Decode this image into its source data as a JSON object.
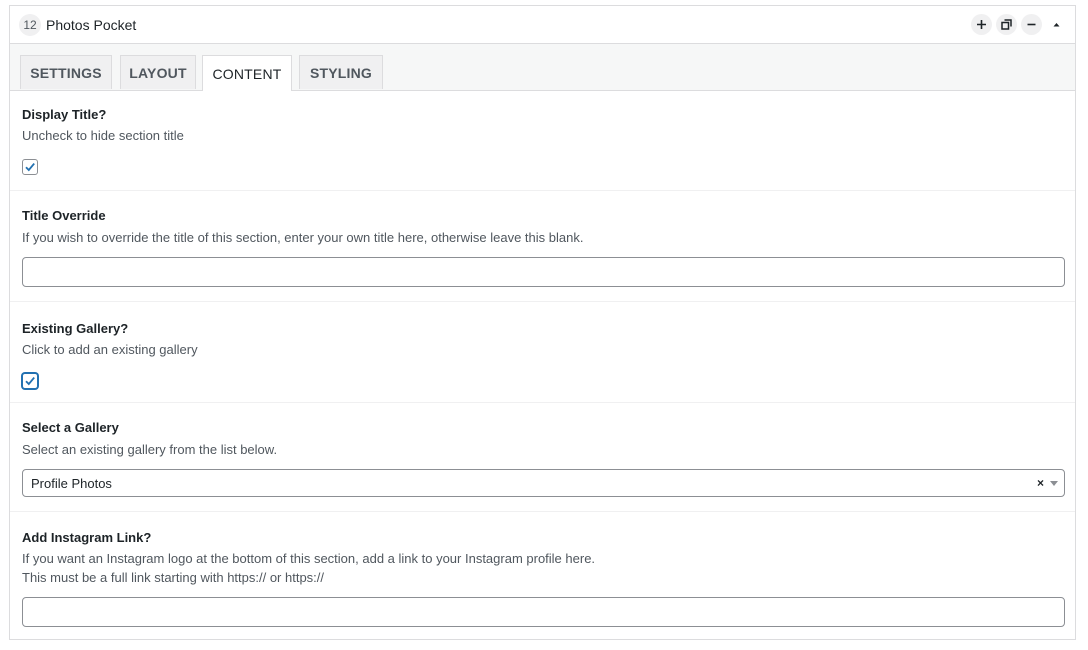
{
  "header": {
    "badge": "12",
    "title": "Photos Pocket"
  },
  "tabs": [
    {
      "label": "SETTINGS"
    },
    {
      "label": "LAYOUT"
    },
    {
      "label": "CONTENT"
    },
    {
      "label": "STYLING"
    }
  ],
  "fields": {
    "display_title": {
      "label": "Display Title?",
      "desc": "Uncheck to hide section title",
      "checked": true
    },
    "title_override": {
      "label": "Title Override",
      "desc": "If you wish to override the title of this section, enter your own title here, otherwise leave this blank.",
      "value": ""
    },
    "existing_gallery": {
      "label": "Existing Gallery?",
      "desc": "Click to add an existing gallery",
      "checked": true
    },
    "select_gallery": {
      "label": "Select a Gallery",
      "desc": "Select an existing gallery from the list below.",
      "selected": "Profile Photos",
      "clear": "×"
    },
    "instagram_link": {
      "label": "Add Instagram Link?",
      "desc_line1": "If you want an Instagram logo at the bottom of this section, add a link to your Instagram profile here.",
      "desc_line2": "This must be a full link starting with https:// or https://",
      "value": ""
    }
  },
  "colors": {
    "accent": "#2271b1",
    "border": "#dcdcde",
    "text": "#1d2327"
  }
}
